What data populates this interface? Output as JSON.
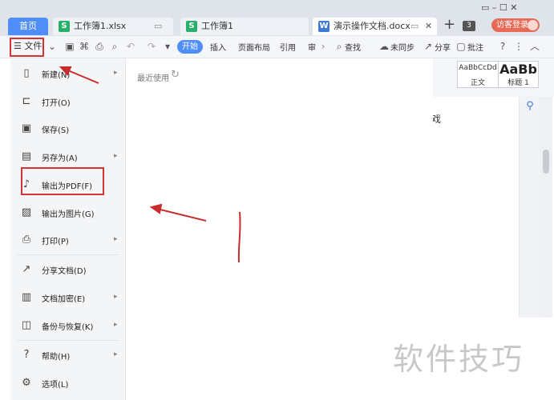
{
  "tabs": {
    "home": "首页",
    "items": [
      {
        "label": "工作簿1.xlsx",
        "icon": "S"
      },
      {
        "label": "工作簿1",
        "icon": "S"
      },
      {
        "label": "演示操作文档.docx",
        "icon": "W"
      }
    ],
    "count_badge": "3",
    "login": "访客登录"
  },
  "toolbar": {
    "file_label": "文件",
    "start": "开始",
    "menus": [
      "插入",
      "页面布局",
      "引用",
      "审"
    ],
    "search": "查找",
    "sync": "未同步",
    "share": "分享",
    "comment": "批注"
  },
  "styles": [
    {
      "sample": "AaBbCcDd",
      "caption": "正文"
    },
    {
      "sample": "AaBb",
      "caption": "标题 1"
    }
  ],
  "file_menu": {
    "items": [
      {
        "label": "新建(N)",
        "icon": "new-doc-icon",
        "has_submenu": true
      },
      {
        "label": "打开(O)",
        "icon": "folder-open-icon",
        "has_submenu": false
      },
      {
        "label": "保存(S)",
        "icon": "save-icon",
        "has_submenu": false
      },
      {
        "label": "另存为(A)",
        "icon": "save-as-icon",
        "has_submenu": true
      },
      {
        "label": "输出为PDF(F)",
        "icon": "pdf-icon",
        "has_submenu": false
      },
      {
        "label": "输出为图片(G)",
        "icon": "image-icon",
        "has_submenu": false
      },
      {
        "label": "打印(P)",
        "icon": "print-icon",
        "has_submenu": true
      },
      {
        "label": "分享文档(D)",
        "icon": "share-icon",
        "has_submenu": false
      },
      {
        "label": "文档加密(E)",
        "icon": "lock-icon",
        "has_submenu": true
      },
      {
        "label": "备份与恢复(K)",
        "icon": "backup-icon",
        "has_submenu": true
      },
      {
        "label": "帮助(H)",
        "icon": "help-icon",
        "has_submenu": true
      },
      {
        "label": "选项(L)",
        "icon": "gear-icon",
        "has_submenu": false
      }
    ]
  },
  "recent": {
    "label": "最近使用"
  },
  "document": {
    "visible_char": "戏"
  },
  "watermark": "软件技巧",
  "colors": {
    "accent": "#4f8ef7",
    "highlight": "#d23434",
    "login": "#e86a56"
  }
}
